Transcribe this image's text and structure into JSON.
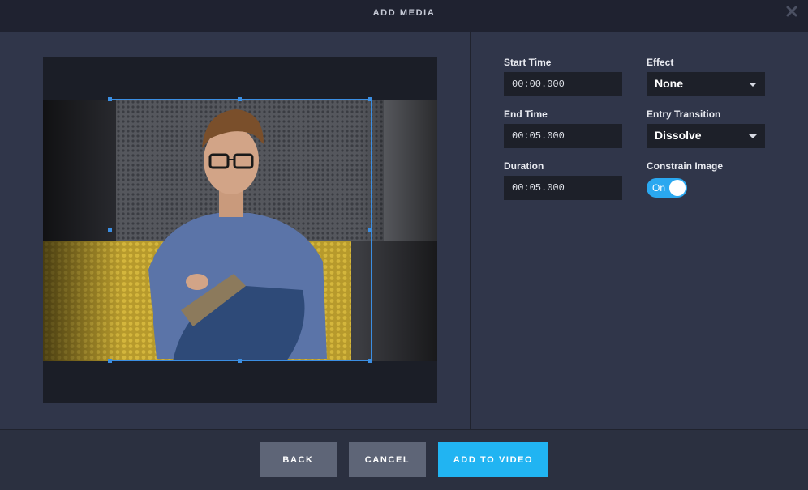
{
  "header": {
    "title": "ADD MEDIA",
    "close_icon": "close-icon"
  },
  "preview": {
    "image_description_icon": "photo-preview"
  },
  "fields": {
    "start_time": {
      "label": "Start Time",
      "value": "00:00.000"
    },
    "end_time": {
      "label": "End Time",
      "value": "00:05.000"
    },
    "duration": {
      "label": "Duration",
      "value": "00:05.000"
    },
    "effect": {
      "label": "Effect",
      "value": "None"
    },
    "entry_transition": {
      "label": "Entry Transition",
      "value": "Dissolve"
    },
    "constrain_image": {
      "label": "Constrain Image",
      "value": "On"
    }
  },
  "footer": {
    "back": "BACK",
    "cancel": "CANCEL",
    "add_to_video": "ADD TO VIDEO"
  },
  "colors": {
    "accent": "#21b4f2",
    "crop_frame": "#3b8ee2",
    "button_grey": "#5e6577"
  }
}
